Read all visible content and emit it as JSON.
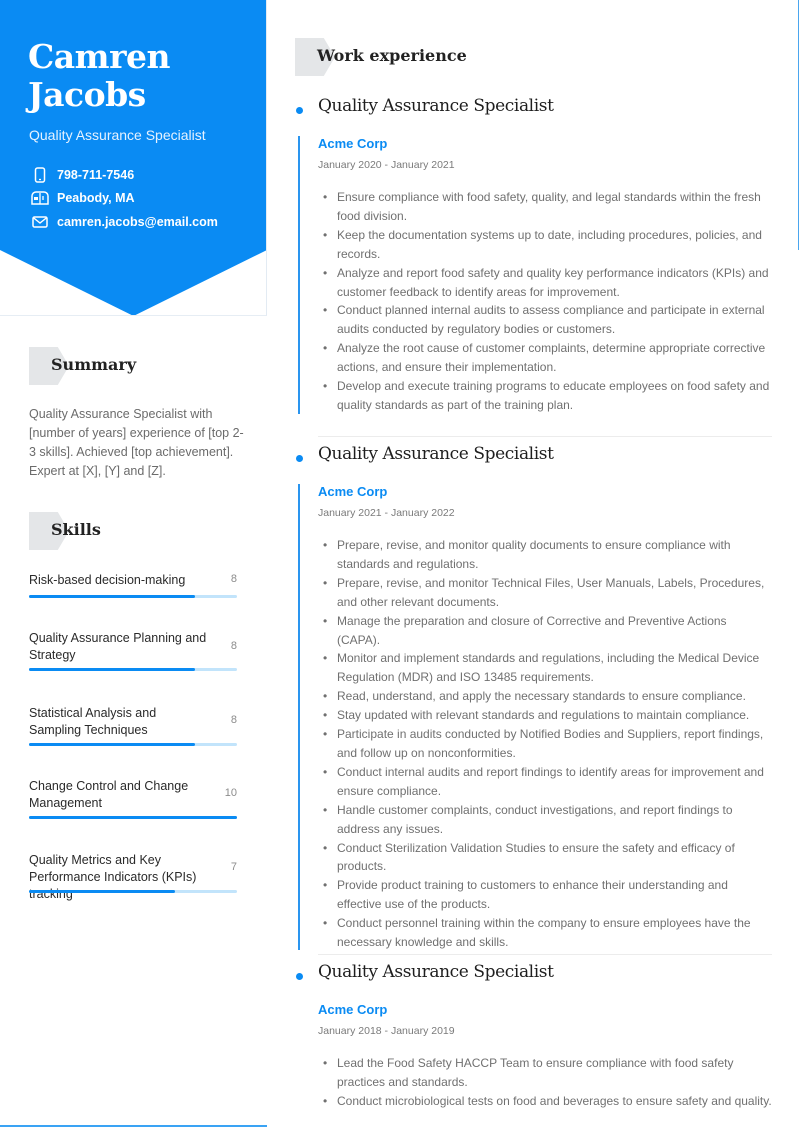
{
  "profile": {
    "name_line1": "Camren",
    "name_line2": "Jacobs",
    "role": "Quality Assurance Specialist",
    "contacts": [
      {
        "icon": "phone-icon",
        "text": "798-711-7546"
      },
      {
        "icon": "mailbox-icon",
        "text": "Peabody, MA"
      },
      {
        "icon": "envelope-icon",
        "text": "camren.jacobs@email.com"
      }
    ]
  },
  "summary": {
    "heading": "Summary",
    "text": "Quality Assurance Specialist with [number of years] experience of [top 2-3 skills]. Achieved [top achievement]. Expert at [X], [Y] and [Z]."
  },
  "skills": {
    "heading": "Skills",
    "max": 10,
    "items": [
      {
        "name": "Risk-based decision-making",
        "value": 8
      },
      {
        "name": "Quality Assurance Planning and Strategy",
        "value": 8
      },
      {
        "name": "Statistical Analysis and Sampling Techniques",
        "value": 8
      },
      {
        "name": "Change Control and Change Management",
        "value": 10
      },
      {
        "name": "Quality Metrics and Key Performance Indicators (KPIs) tracking",
        "value": 7
      }
    ]
  },
  "work": {
    "heading": "Work experience",
    "jobs": [
      {
        "title": "Quality Assurance Specialist",
        "company": "Acme Corp",
        "dates": "January 2020 - January 2021",
        "bullets": [
          "Ensure compliance with food safety, quality, and legal standards within the fresh food division.",
          "Keep the documentation systems up to date, including procedures, policies, and records.",
          "Analyze and report food safety and quality key performance indicators (KPIs) and customer feedback to identify areas for improvement.",
          "Conduct planned internal audits to assess compliance and participate in external audits conducted by regulatory bodies or customers.",
          "Analyze the root cause of customer complaints, determine appropriate corrective actions, and ensure their implementation.",
          "Develop and execute training programs to educate employees on food safety and quality standards as part of the training plan."
        ]
      },
      {
        "title": "Quality Assurance Specialist",
        "company": "Acme Corp",
        "dates": "January 2021 - January 2022",
        "bullets": [
          "Prepare, revise, and monitor quality documents to ensure compliance with standards and regulations.",
          "Prepare, revise, and monitor Technical Files, User Manuals, Labels, Procedures, and other relevant documents.",
          "Manage the preparation and closure of Corrective and Preventive Actions (CAPA).",
          "Monitor and implement standards and regulations, including the Medical Device Regulation (MDR) and ISO 13485 requirements.",
          "Read, understand, and apply the necessary standards to ensure compliance.",
          "Stay updated with relevant standards and regulations to maintain compliance.",
          "Participate in audits conducted by Notified Bodies and Suppliers, report findings, and follow up on nonconformities.",
          "Conduct internal audits and report findings to identify areas for improvement and ensure compliance.",
          "Handle customer complaints, conduct investigations, and report findings to address any issues.",
          "Conduct Sterilization Validation Studies to ensure the safety and efficacy of products.",
          "Provide product training to customers to enhance their understanding and effective use of the products.",
          "Conduct personnel training within the company to ensure employees have the necessary knowledge and skills."
        ]
      },
      {
        "title": "Quality Assurance Specialist",
        "company": "Acme Corp",
        "dates": "January 2018 - January 2019",
        "bullets": [
          "Lead the Food Safety HACCP Team to ensure compliance with food safety practices and standards.",
          "Conduct microbiological tests on food and beverages to ensure safety and quality."
        ]
      }
    ]
  },
  "colors": {
    "accent": "#0a8bf3",
    "bar_track": "#c2e4fb",
    "tag_bg": "#e4e6e8"
  }
}
